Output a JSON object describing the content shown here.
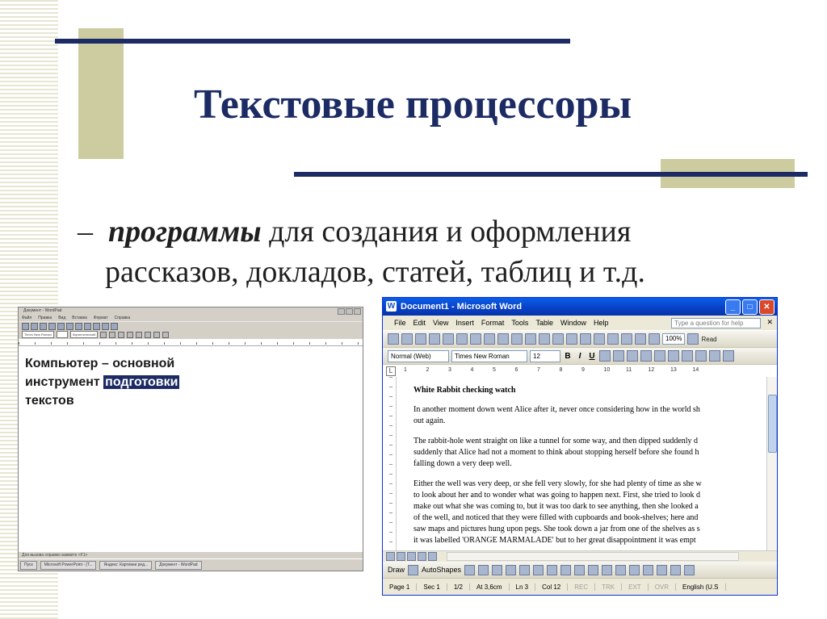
{
  "slide": {
    "title": "Текстовые процессоры",
    "bullet_dash": "–",
    "bullet_emphasis": "программы",
    "bullet_rest_line1": " для создания и оформления",
    "bullet_line2": "рассказов, докладов, статей, таблиц и т.д.",
    "colors": {
      "accent": "#1c2b63",
      "block": "#cccca0"
    }
  },
  "wordpad": {
    "title": "Документ - WordPad",
    "menu": [
      "Файл",
      "Правка",
      "Вид",
      "Вставка",
      "Формат",
      "Справка"
    ],
    "font_name": "Times New Roman",
    "script": "Кириллический",
    "doc_line1": "Компьютер – основной",
    "doc_line2_plain": "инструмент ",
    "doc_line2_highlight": "подготовки",
    "doc_line3": "текстов",
    "status": "Для вызова справки нажмите <F1>",
    "taskbar": [
      "Пуск",
      "Microsoft PowerPoint - [Т...",
      "Яндекс: Картинки ред...",
      "Документ - WordPad"
    ]
  },
  "word": {
    "title": "Document1 - Microsoft Word",
    "app_icon": "word-icon",
    "menu": [
      "File",
      "Edit",
      "View",
      "Insert",
      "Format",
      "Tools",
      "Table",
      "Window",
      "Help"
    ],
    "help_placeholder": "Type a question for help",
    "zoom": "100%",
    "read_label": "Read",
    "style": "Normal (Web)",
    "font": "Times New Roman",
    "size": "12",
    "ruler_numbers": [
      "1",
      "2",
      "3",
      "4",
      "5",
      "6",
      "7",
      "8",
      "9",
      "10",
      "11",
      "12",
      "13",
      "14"
    ],
    "doc": {
      "heading": "White Rabbit checking watch",
      "p1": [
        "In another moment down went Alice after it, never once considering how in the world sh",
        "out again."
      ],
      "p2": [
        "The rabbit-hole went straight on like a tunnel for some way, and then dipped suddenly d",
        "suddenly that Alice had not a moment to think about stopping herself before she found h",
        "falling down a very deep well."
      ],
      "p3": [
        "Either the well was very deep, or she fell very slowly, for she had plenty of time as she w",
        "to look about her and to wonder what was going to happen next. First, she tried to look d",
        "make out what she was coming to, but it was too dark to see anything, then she looked a",
        "of the well, and noticed that they were filled with cupboards and book-shelves; here and",
        "saw maps and pictures hung upon pegs. She took down a jar from one of the shelves as s",
        "it was labelled 'ORANGE MARMALADE' but to her great disappointment it was empt"
      ]
    },
    "draw_label": "Draw",
    "autoshapes_label": "AutoShapes",
    "status": {
      "page": "Page 1",
      "sec": "Sec 1",
      "pages": "1/2",
      "at": "At 3,6cm",
      "ln": "Ln 3",
      "col": "Col 12",
      "rec": "REC",
      "trk": "TRK",
      "ext": "EXT",
      "ovr": "OVR",
      "lang": "English (U.S"
    }
  }
}
